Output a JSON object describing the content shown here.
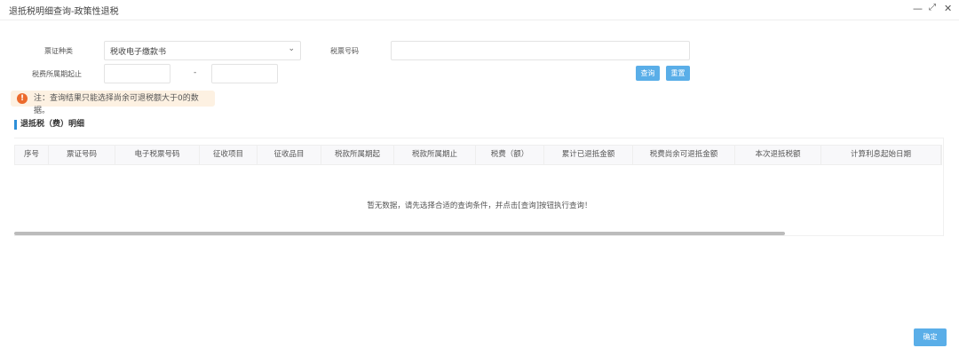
{
  "window": {
    "title": "退抵税明细查询-政策性退税",
    "minimize_icon": "minimize-icon",
    "maximize_icon": "maximize-icon",
    "close_icon": "close-icon"
  },
  "form": {
    "ticket_type_label": "票证种类",
    "ticket_type_value": "税收电子缴款书",
    "tax_ticket_no_label": "税票号码",
    "tax_ticket_no_value": "",
    "period_label": "税费所属期起止",
    "period_start": "",
    "period_sep": "-",
    "period_end": "",
    "query_label": "查询",
    "reset_label": "重置"
  },
  "note": {
    "icon": "!",
    "text": "注：查询结果只能选择尚余可退税额大于0的数据。"
  },
  "section_title": "退抵税（费）明细",
  "table": {
    "columns": [
      "序号",
      "票证号码",
      "电子税票号码",
      "征收项目",
      "征收品目",
      "税款所属期起",
      "税款所属期止",
      "税费（额）",
      "累计已退抵金额",
      "税费尚余可退抵金额",
      "本次退抵税额",
      "计算利息起始日期"
    ],
    "empty_text": "暂无数据，请先选择合适的查询条件，并点击[查询]按钮执行查询！"
  },
  "footer": {
    "confirm_label": "确定"
  },
  "colors": {
    "accent": "#5aaee8",
    "warning": "#ec6a2c",
    "note_bg": "#fdf1e2"
  }
}
